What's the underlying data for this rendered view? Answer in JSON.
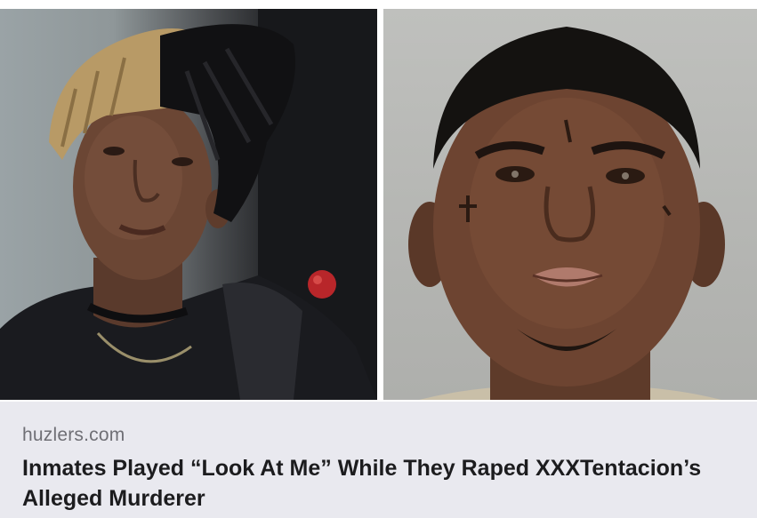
{
  "article": {
    "source": "huzlers.com",
    "headline": "Inmates Played “Look At Me” While They Raped XXXTentacion’s Alleged Murderer"
  },
  "colors": {
    "caption_background": "#e9e9ef",
    "source_text": "#6f6f75",
    "headline_text": "#1c1c1e"
  }
}
